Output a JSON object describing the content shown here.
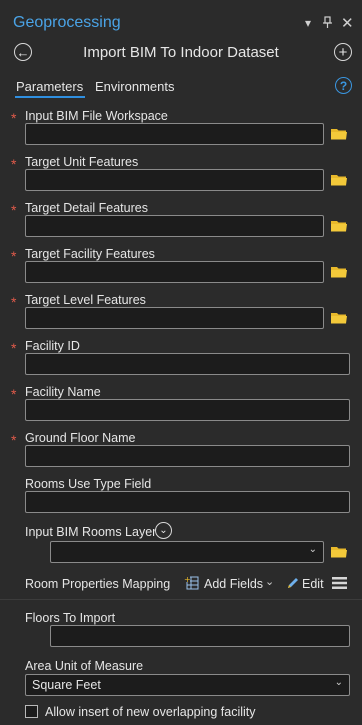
{
  "pane": {
    "title": "Geoprocessing",
    "tool_title": "Import BIM To Indoor Dataset"
  },
  "tabs": [
    {
      "label": "Parameters"
    },
    {
      "label": "Environments"
    }
  ],
  "params": {
    "input_bim": "Input BIM File Workspace",
    "target_unit": "Target Unit Features",
    "target_detail": "Target Detail Features",
    "target_facility": "Target Facility Features",
    "target_level": "Target Level Features",
    "facility_id": "Facility ID",
    "facility_name": "Facility Name",
    "ground_floor": "Ground Floor Name",
    "rooms_use_type": "Rooms Use Type Field",
    "input_rooms_layer": "Input BIM Rooms Layer",
    "room_mapping": "Room Properties Mapping",
    "add_fields": "Add Fields",
    "edit": "Edit",
    "floors_to_import": "Floors To Import",
    "area_unit": "Area Unit of Measure",
    "area_unit_value": "Square Feet",
    "allow_insert": "Allow insert of new overlapping facility"
  },
  "required_marker": "*",
  "colors": {
    "accent": "#4aa3e6",
    "required": "#e05a4a",
    "folder": "#e8b92b"
  }
}
